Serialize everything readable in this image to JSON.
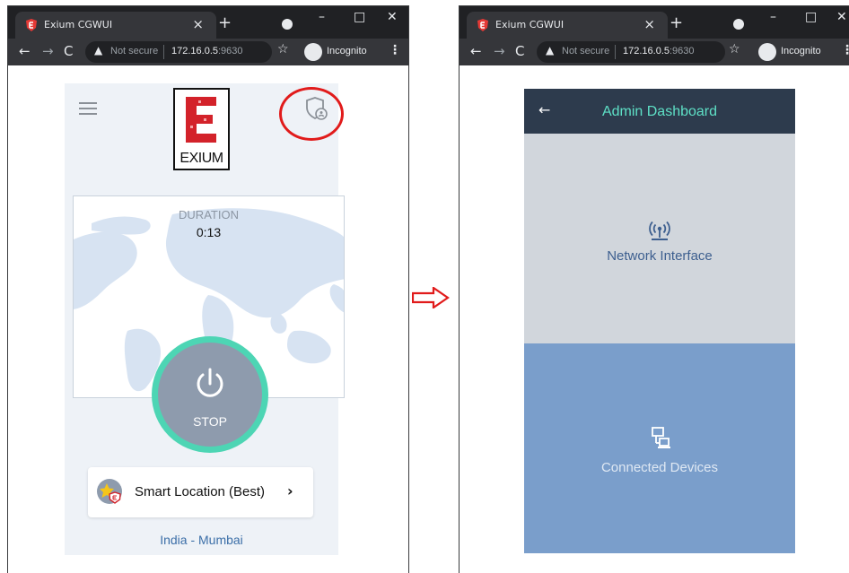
{
  "browser": {
    "tab_title": "Exium CGWUI",
    "tab_close": "×",
    "new_tab": "+",
    "not_secure": "Not secure",
    "url_host": "172.16.0.5",
    "url_port": ":9630",
    "incognito": "Incognito"
  },
  "left_page": {
    "logo_text": "EXIUM",
    "duration_label": "DURATION",
    "duration_value": "0:13",
    "stop_label": "STOP",
    "location_label": "Smart Location (Best)",
    "location_chevron": "›",
    "city": "India - Mumbai"
  },
  "right_page": {
    "title": "Admin Dashboard",
    "back_icon": "←",
    "cards": [
      {
        "label": "Network Interface",
        "icon": "antenna-icon"
      },
      {
        "label": "Connected Devices",
        "icon": "devices-icon"
      }
    ]
  },
  "colors": {
    "annotation": "#e11b1b",
    "accent_teal": "#4dd5b4",
    "header_bg": "#2d3b4d",
    "devices_bg": "#7a9ecb"
  }
}
